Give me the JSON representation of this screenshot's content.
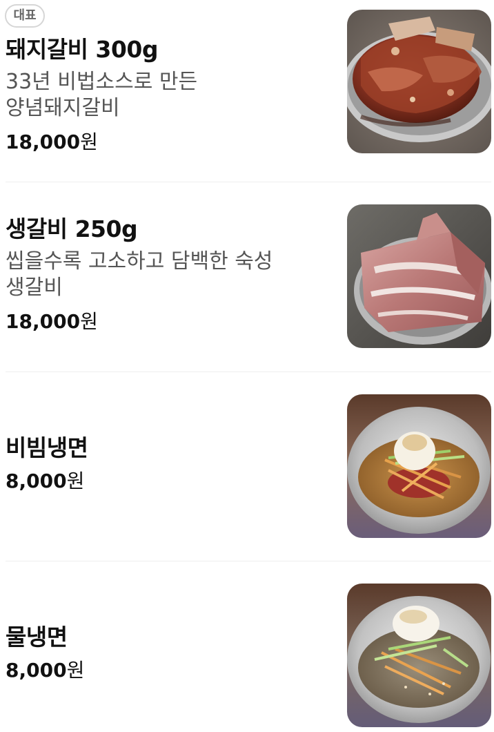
{
  "menu": {
    "items": [
      {
        "badge": "대표",
        "name": "돼지갈비 300g",
        "description": "33년 비법소스로 만든 양념돼지갈비",
        "price_num": "18,000",
        "price_unit": "원",
        "image_icon": "marinated-pork-ribs-photo"
      },
      {
        "name": "생갈비 250g",
        "description": "씹을수록 고소하고 담백한 숙성 생갈비",
        "price_num": "18,000",
        "price_unit": "원",
        "image_icon": "raw-ribs-photo"
      },
      {
        "name": "비빔냉면",
        "price_num": "8,000",
        "price_unit": "원",
        "image_icon": "bibim-naengmyeon-photo"
      },
      {
        "name": "물냉면",
        "price_num": "8,000",
        "price_unit": "원",
        "image_icon": "mul-naengmyeon-photo"
      }
    ]
  },
  "colors": {
    "text_primary": "#111111",
    "text_secondary": "#555555",
    "divider": "#eeeeee",
    "badge_border": "#d6d6d6"
  }
}
